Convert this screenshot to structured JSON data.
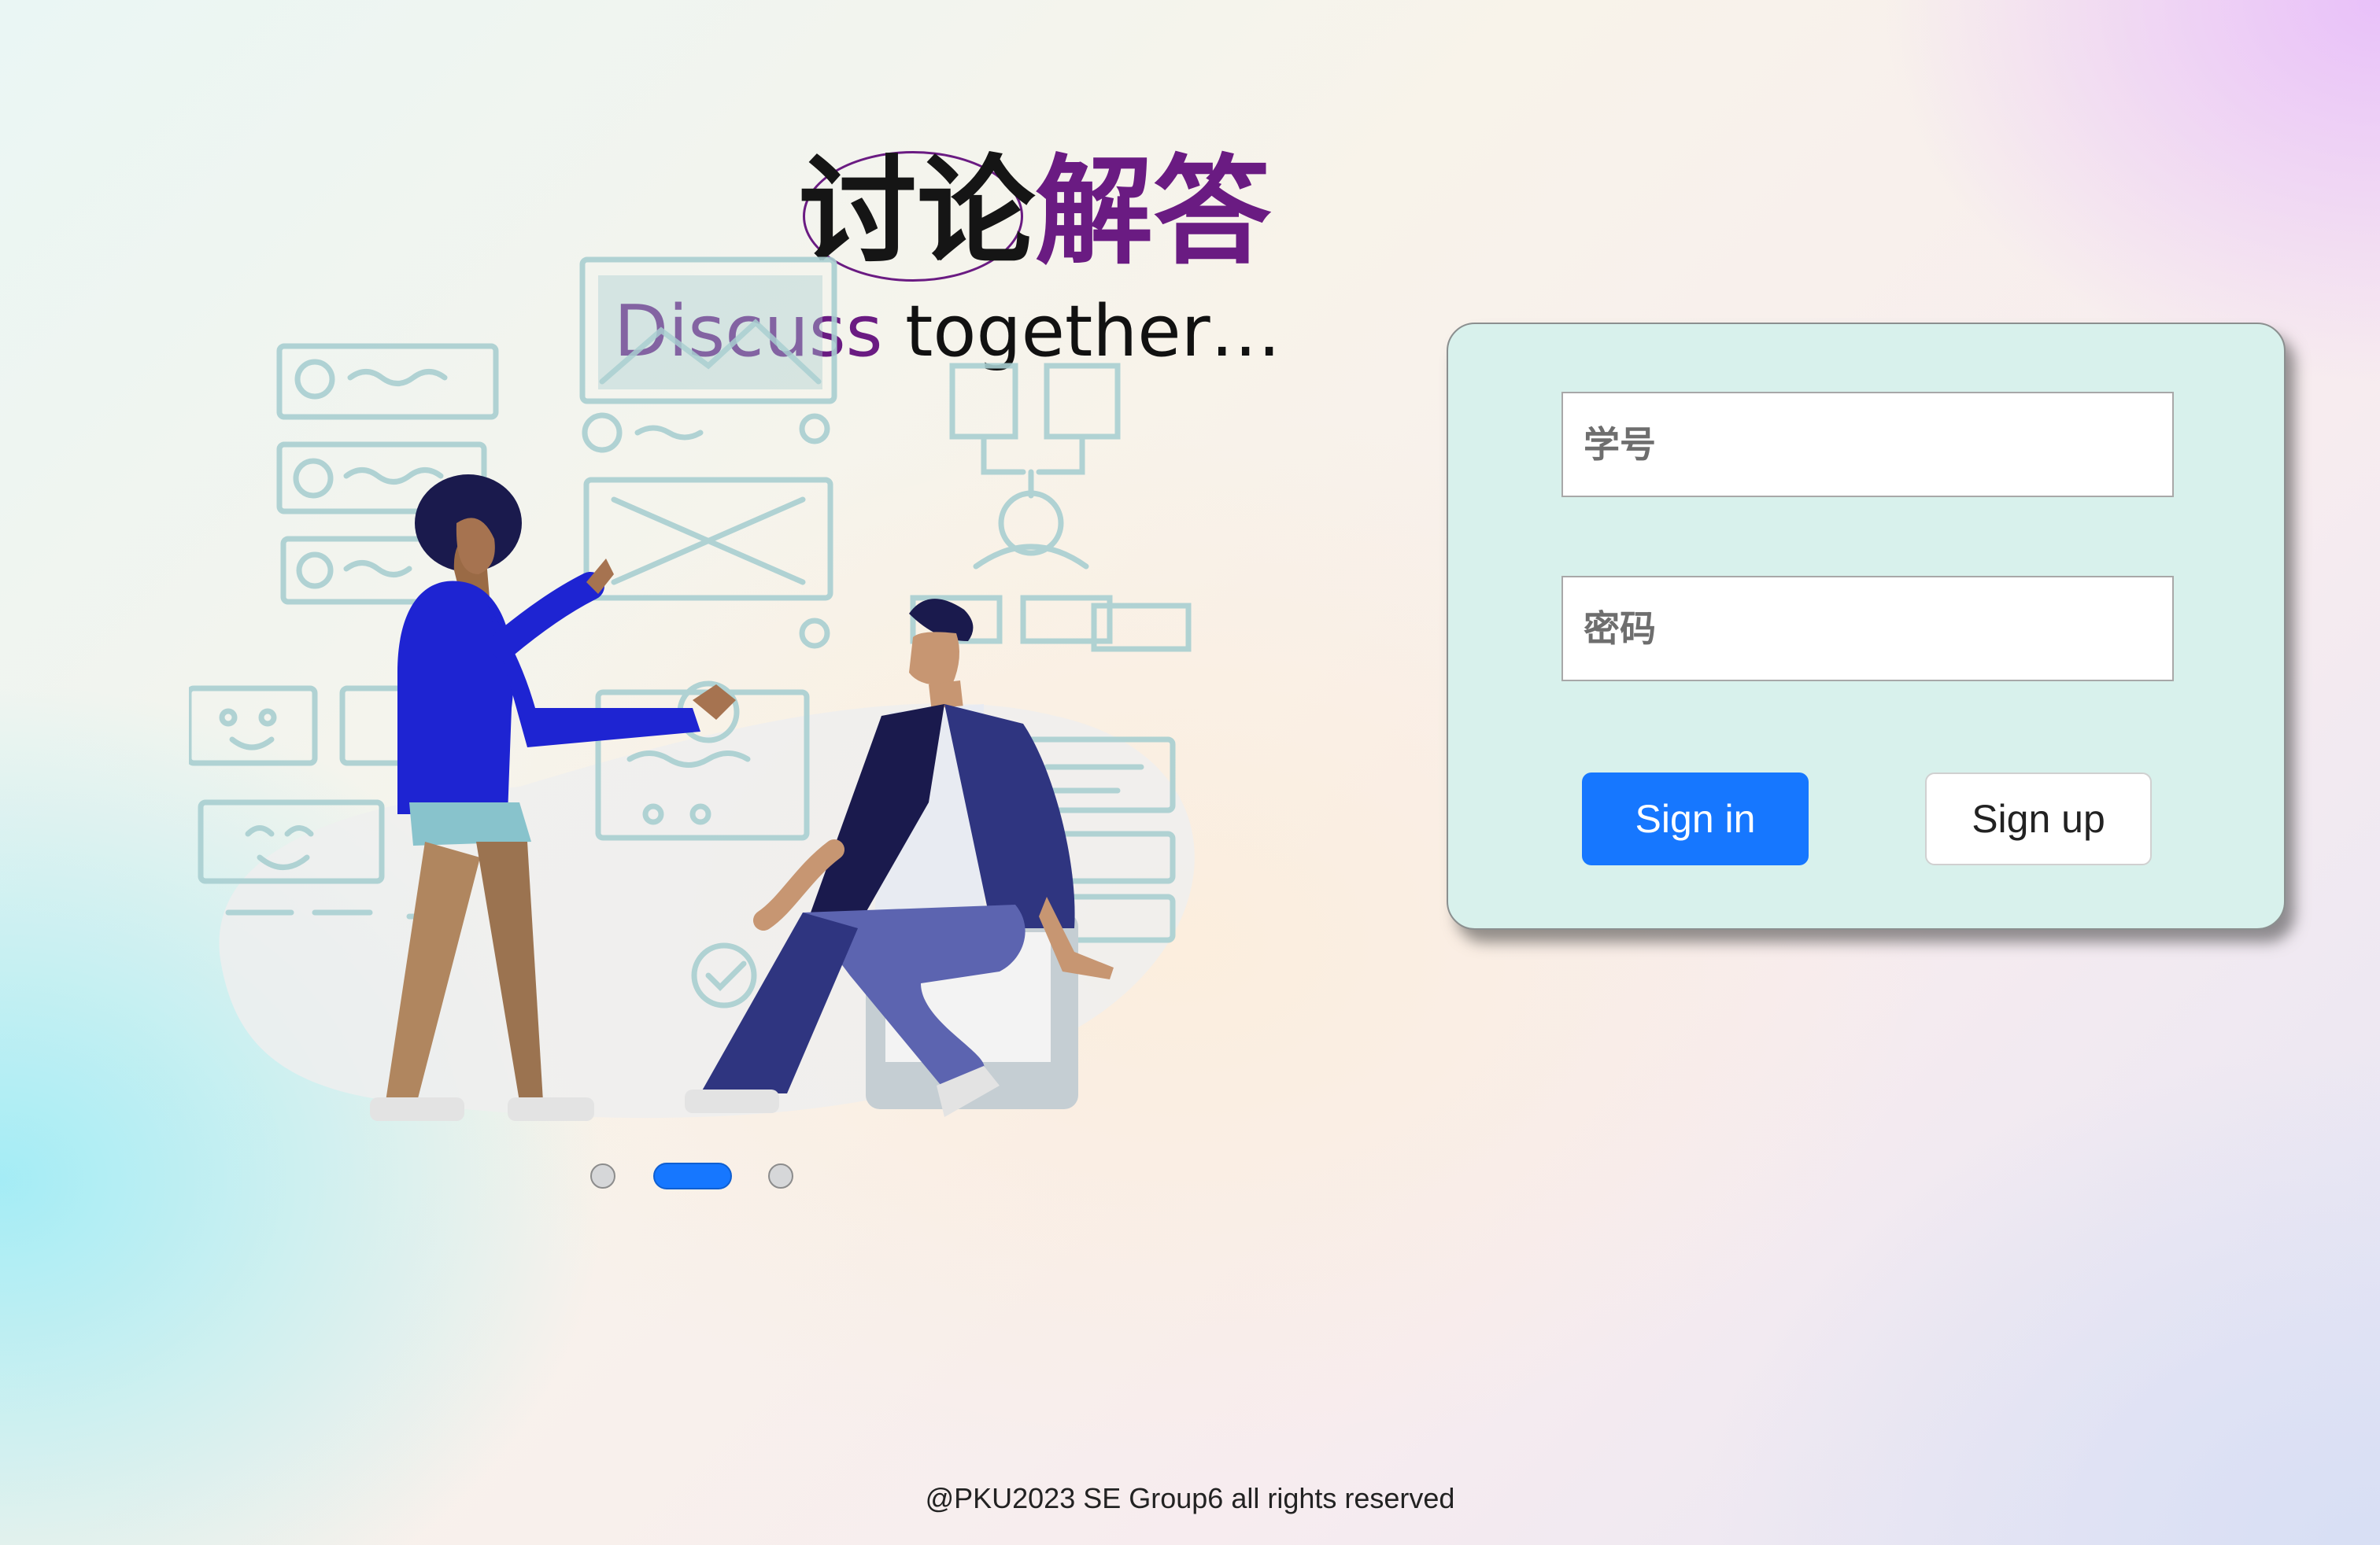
{
  "title": {
    "cn_dark": "讨论",
    "cn_purple": "解答",
    "en_purple": "Discuss",
    "en_dark": " together…"
  },
  "carousel": {
    "slide_count": 3,
    "active_index": 1
  },
  "login": {
    "student_id_placeholder": "学号",
    "password_placeholder": "密码",
    "sign_in_label": "Sign in",
    "sign_up_label": "Sign up"
  },
  "footer": {
    "text": "@PKU2023 SE Group6 all rights reserved"
  },
  "colors": {
    "brand_purple": "#6a1b82",
    "primary_button": "#1677ff",
    "panel_background": "#d8f1ec"
  }
}
